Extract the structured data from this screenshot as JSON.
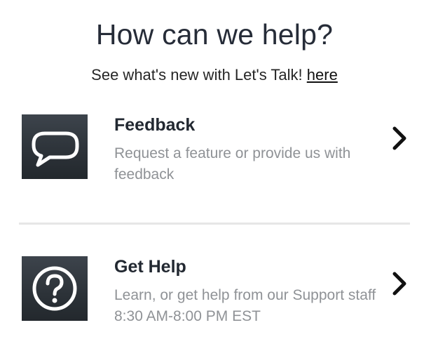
{
  "header": {
    "title": "How can we help?",
    "subtitle_prefix": "See what's new with Let's Talk! ",
    "subtitle_link": "here"
  },
  "options": [
    {
      "title": "Feedback",
      "description": "Request a feature or provide us with feedback",
      "icon": "speech-bubble-icon"
    },
    {
      "title": "Get Help",
      "description": "Learn, or get help from our Support staff 8:30 AM-8:00 PM EST",
      "icon": "question-circle-icon"
    }
  ],
  "colors": {
    "tile_background": "#2c3238",
    "title_text": "#262c38",
    "description_text": "#8f9296",
    "divider": "#e6e6e6"
  }
}
